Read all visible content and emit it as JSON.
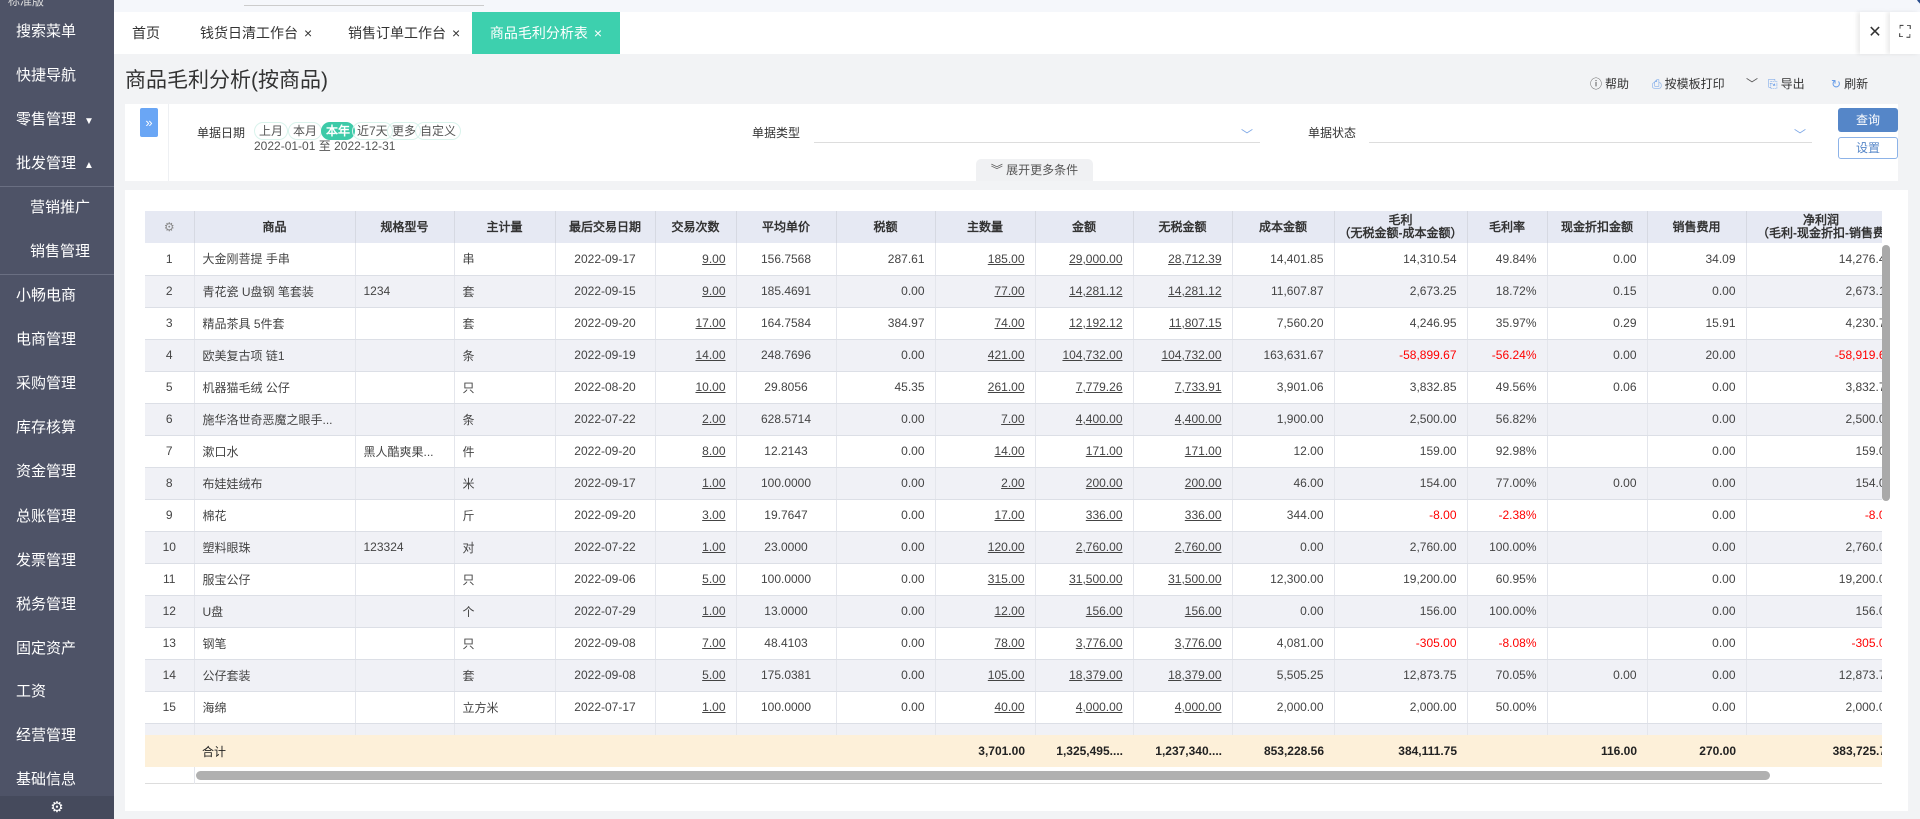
{
  "app": {
    "edition": "标准版"
  },
  "sidebar": {
    "items": [
      {
        "label": "搜索菜单"
      },
      {
        "label": "快捷导航"
      },
      {
        "label": "零售管理",
        "caret": "▼"
      },
      {
        "label": "批发管理",
        "caret": "▲"
      },
      {
        "label": "营销推广",
        "sub": true
      },
      {
        "label": "销售管理",
        "sub": true
      },
      {
        "label": "小畅电商"
      },
      {
        "label": "电商管理"
      },
      {
        "label": "采购管理"
      },
      {
        "label": "库存核算"
      },
      {
        "label": "资金管理"
      },
      {
        "label": "总账管理"
      },
      {
        "label": "发票管理"
      },
      {
        "label": "税务管理"
      },
      {
        "label": "固定资产"
      },
      {
        "label": "工资"
      },
      {
        "label": "经营管理"
      },
      {
        "label": "基础信息"
      }
    ],
    "settings_icon": "gear-icon"
  },
  "tabs": [
    {
      "label": "首页",
      "closable": false
    },
    {
      "label": "钱货日清工作台",
      "closable": true
    },
    {
      "label": "销售订单工作台",
      "closable": true
    },
    {
      "label": "商品毛利分析表",
      "closable": true,
      "active": true
    }
  ],
  "tab_close_glyph": "×",
  "window": {
    "close_glyph": "✕",
    "fullscreen_glyph": "⛶"
  },
  "page": {
    "title": "商品毛利分析(按商品)"
  },
  "toolbar": {
    "help": "帮助",
    "print": "按模板打印",
    "export": "导出",
    "refresh": "刷新"
  },
  "filters": {
    "date_label": "单据日期",
    "date_chips": [
      "上月",
      "本月",
      "本年",
      "近7天",
      "更多",
      "自定义"
    ],
    "date_selected": "本年",
    "date_from": "2022-01-01",
    "date_sep": "至",
    "date_to": "2022-12-31",
    "type_label": "单据类型",
    "type_value": "",
    "status_label": "单据状态",
    "status_value": "",
    "query_button": "查询",
    "settings_button": "设置",
    "more_conditions": "展开更多条件"
  },
  "colors": {
    "accent": "#3dd0ae",
    "primary": "#5586c8",
    "negative": "#ff0000",
    "sidebar": "#4e5367",
    "footer": "#fdf0d9"
  },
  "table": {
    "columns": [
      {
        "key": "idx",
        "label": ""
      },
      {
        "key": "name",
        "label": "商品"
      },
      {
        "key": "spec",
        "label": "规格型号"
      },
      {
        "key": "unit",
        "label": "主计量"
      },
      {
        "key": "last_date",
        "label": "最后交易日期"
      },
      {
        "key": "count",
        "label": "交易次数",
        "link": true
      },
      {
        "key": "avg_price",
        "label": "平均单价"
      },
      {
        "key": "tax",
        "label": "税额"
      },
      {
        "key": "qty",
        "label": "主数量",
        "link": true
      },
      {
        "key": "amount",
        "label": "金额",
        "link": true
      },
      {
        "key": "net_amount",
        "label": "无税金额",
        "link": true
      },
      {
        "key": "cost",
        "label": "成本金额"
      },
      {
        "key": "gross",
        "label": "毛利",
        "sub": "（无税金额-成本金额）"
      },
      {
        "key": "gross_rate",
        "label": "毛利率"
      },
      {
        "key": "discount",
        "label": "现金折扣金额"
      },
      {
        "key": "sales_fee",
        "label": "销售费用"
      },
      {
        "key": "net_profit",
        "label": "净利润",
        "sub": "（毛利-现金折扣-销售费"
      }
    ],
    "rows": [
      [
        "1",
        "大金刚菩提 手串",
        "",
        "串",
        "2022-09-17",
        "9.00",
        "156.7568",
        "287.61",
        "185.00",
        "29,000.00",
        "28,712.39",
        "14,401.85",
        "14,310.54",
        "49.84%",
        "0.00",
        "34.09",
        "14,276.4"
      ],
      [
        "2",
        "青花瓷 U盘钢 笔套装",
        "1234",
        "套",
        "2022-09-15",
        "9.00",
        "185.4691",
        "0.00",
        "77.00",
        "14,281.12",
        "14,281.12",
        "11,607.87",
        "2,673.25",
        "18.72%",
        "0.15",
        "0.00",
        "2,673.1"
      ],
      [
        "3",
        "精品茶具 5件套",
        "",
        "套",
        "2022-09-20",
        "17.00",
        "164.7584",
        "384.97",
        "74.00",
        "12,192.12",
        "11,807.15",
        "7,560.20",
        "4,246.95",
        "35.97%",
        "0.29",
        "15.91",
        "4,230.7"
      ],
      [
        "4",
        "欧美复古项 链1",
        "",
        "条",
        "2022-09-19",
        "14.00",
        "248.7696",
        "0.00",
        "421.00",
        "104,732.00",
        "104,732.00",
        "163,631.67",
        "-58,899.67",
        "-56.24%",
        "0.00",
        "20.00",
        "-58,919.6"
      ],
      [
        "5",
        "机器猫毛绒 公仔",
        "",
        "只",
        "2022-08-20",
        "10.00",
        "29.8056",
        "45.35",
        "261.00",
        "7,779.26",
        "7,733.91",
        "3,901.06",
        "3,832.85",
        "49.56%",
        "0.06",
        "0.00",
        "3,832.7"
      ],
      [
        "6",
        "施华洛世奇恶魔之眼手...",
        "",
        "条",
        "2022-07-22",
        "2.00",
        "628.5714",
        "0.00",
        "7.00",
        "4,400.00",
        "4,400.00",
        "1,900.00",
        "2,500.00",
        "56.82%",
        "",
        "0.00",
        "2,500.0"
      ],
      [
        "7",
        "漱口水",
        "黑人酷爽果...",
        "件",
        "2022-09-20",
        "8.00",
        "12.2143",
        "0.00",
        "14.00",
        "171.00",
        "171.00",
        "12.00",
        "159.00",
        "92.98%",
        "",
        "0.00",
        "159.0"
      ],
      [
        "8",
        "布娃娃绒布",
        "",
        "米",
        "2022-09-17",
        "1.00",
        "100.0000",
        "0.00",
        "2.00",
        "200.00",
        "200.00",
        "46.00",
        "154.00",
        "77.00%",
        "0.00",
        "0.00",
        "154.0"
      ],
      [
        "9",
        "棉花",
        "",
        "斤",
        "2022-09-20",
        "3.00",
        "19.7647",
        "0.00",
        "17.00",
        "336.00",
        "336.00",
        "344.00",
        "-8.00",
        "-2.38%",
        "",
        "0.00",
        "-8.0"
      ],
      [
        "10",
        "塑料眼珠",
        "123324",
        "对",
        "2022-07-22",
        "1.00",
        "23.0000",
        "0.00",
        "120.00",
        "2,760.00",
        "2,760.00",
        "0.00",
        "2,760.00",
        "100.00%",
        "",
        "0.00",
        "2,760.0"
      ],
      [
        "11",
        "服宝公仔",
        "",
        "只",
        "2022-09-06",
        "5.00",
        "100.0000",
        "0.00",
        "315.00",
        "31,500.00",
        "31,500.00",
        "12,300.00",
        "19,200.00",
        "60.95%",
        "",
        "0.00",
        "19,200.0"
      ],
      [
        "12",
        "U盘",
        "",
        "个",
        "2022-07-29",
        "1.00",
        "13.0000",
        "0.00",
        "12.00",
        "156.00",
        "156.00",
        "0.00",
        "156.00",
        "100.00%",
        "",
        "0.00",
        "156.0"
      ],
      [
        "13",
        "钢笔",
        "",
        "只",
        "2022-09-08",
        "7.00",
        "48.4103",
        "0.00",
        "78.00",
        "3,776.00",
        "3,776.00",
        "4,081.00",
        "-305.00",
        "-8.08%",
        "",
        "0.00",
        "-305.0"
      ],
      [
        "14",
        "公仔套装",
        "",
        "套",
        "2022-09-08",
        "5.00",
        "175.0381",
        "0.00",
        "105.00",
        "18,379.00",
        "18,379.00",
        "5,505.25",
        "12,873.75",
        "70.05%",
        "0.00",
        "0.00",
        "12,873.7"
      ],
      [
        "15",
        "海绵",
        "",
        "立方米",
        "2022-07-17",
        "1.00",
        "100.0000",
        "0.00",
        "40.00",
        "4,000.00",
        "4,000.00",
        "2,000.00",
        "2,000.00",
        "50.00%",
        "",
        "0.00",
        "2,000.0"
      ]
    ],
    "footer": [
      "",
      "合计",
      "",
      "",
      "",
      "",
      "",
      "",
      "3,701.00",
      "1,325,495....",
      "1,237,340....",
      "853,228.56",
      "384,111.75",
      "",
      "116.00",
      "270.00",
      "383,725.7"
    ]
  }
}
